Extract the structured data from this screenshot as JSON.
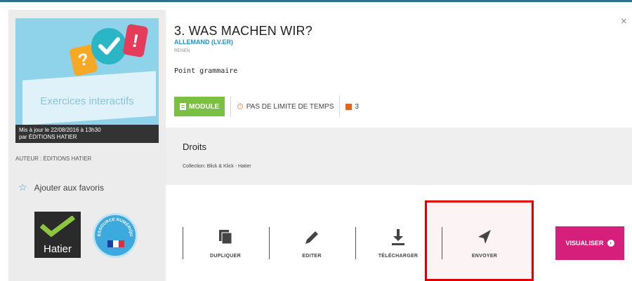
{
  "sidebar": {
    "thumbnail_title": "Exercices interactifs",
    "bubble_question": "?",
    "bubble_exclamation": "!",
    "update_line1": "Mis à jour le 22/08/2016 à 13h30",
    "update_line2": "par ÉDITIONS HATIER",
    "author": "AUTEUR : ÉDITIONS HATIER",
    "favorite_label": "Ajouter aux favoris",
    "logo_label": "Hatier",
    "badge_label": "RESSOURCE NUMÉRIQUE"
  },
  "header": {
    "title": "3. WAS MACHEN WIR?",
    "subject": "ALLEMAND (LV.ER)",
    "subsubject": "REISEN",
    "description": "Point grammaire"
  },
  "chips": {
    "module_label": "MODULE",
    "time_label": "PAS DE LIMITE DE TEMPS",
    "count": "3"
  },
  "rights": {
    "title": "Droits",
    "text": "Collection: Blick & Klick - Hatier"
  },
  "actions": {
    "duplicate": "DUPLIQUER",
    "edit": "EDITER",
    "download": "TÉLÉCHARGER",
    "send": "ENVOYER"
  },
  "visualise_label": "VISUALISER",
  "close_label": "×",
  "colors": {
    "module_green": "#7ac143",
    "accent_blue": "#1e95c8",
    "visualise_pink": "#d61f7b",
    "highlight_red": "#e00000",
    "timer_orange": "#e5671b"
  }
}
